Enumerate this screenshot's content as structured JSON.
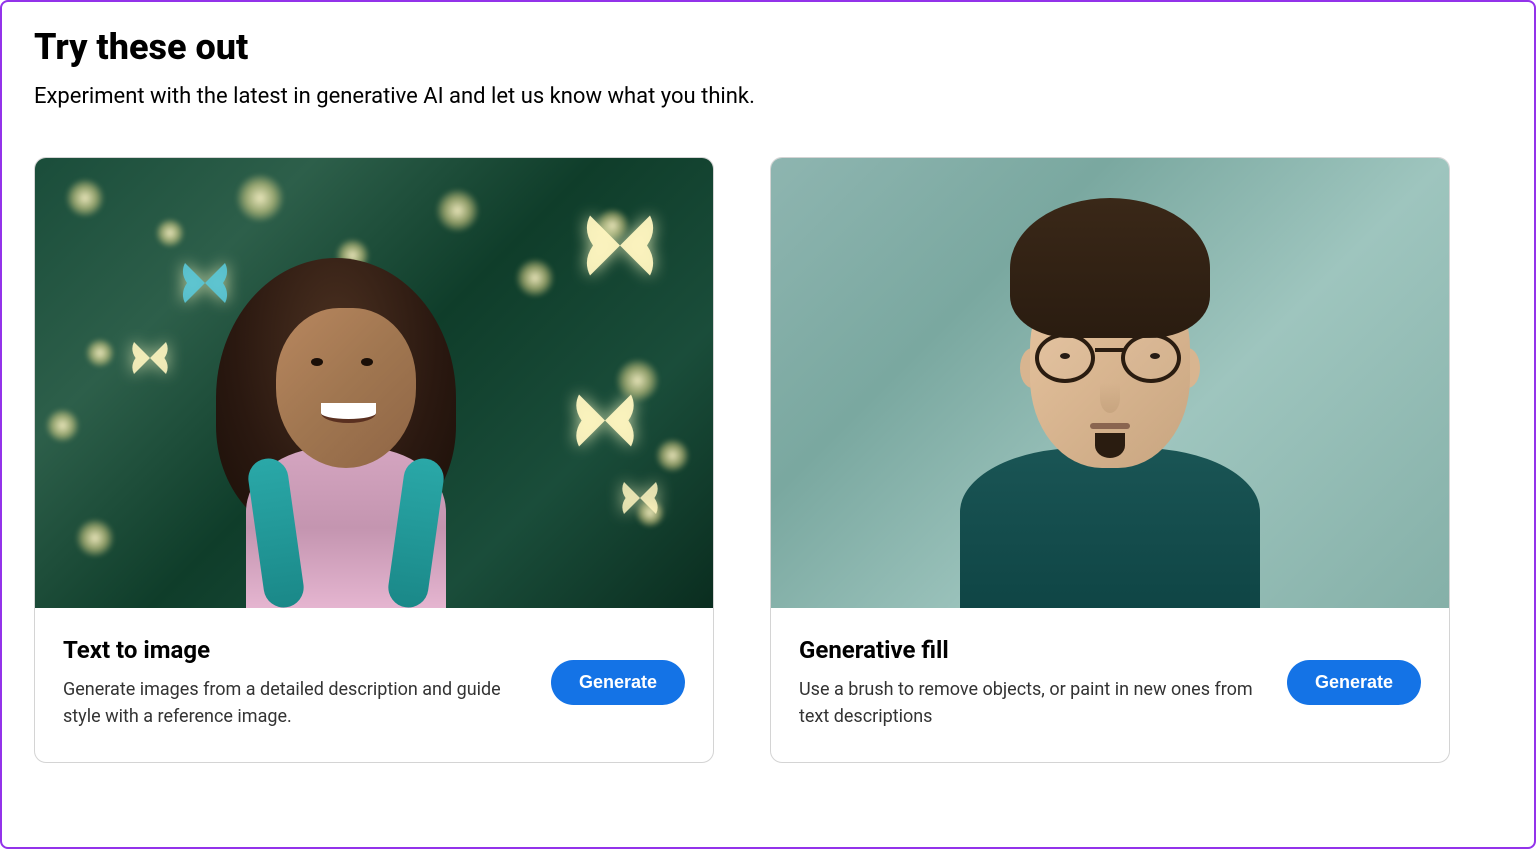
{
  "header": {
    "title": "Try these out",
    "subtitle": "Experiment with the latest in generative AI and let us know what you think."
  },
  "cards": [
    {
      "title": "Text to image",
      "description": "Generate images from a detailed description and guide style with a reference image.",
      "button_label": "Generate",
      "image_alt": "girl-with-butterflies-forest"
    },
    {
      "title": "Generative fill",
      "description": "Use a brush to remove objects, or paint in new ones from text descriptions",
      "button_label": "Generate",
      "image_alt": "man-portrait-glasses"
    }
  ]
}
